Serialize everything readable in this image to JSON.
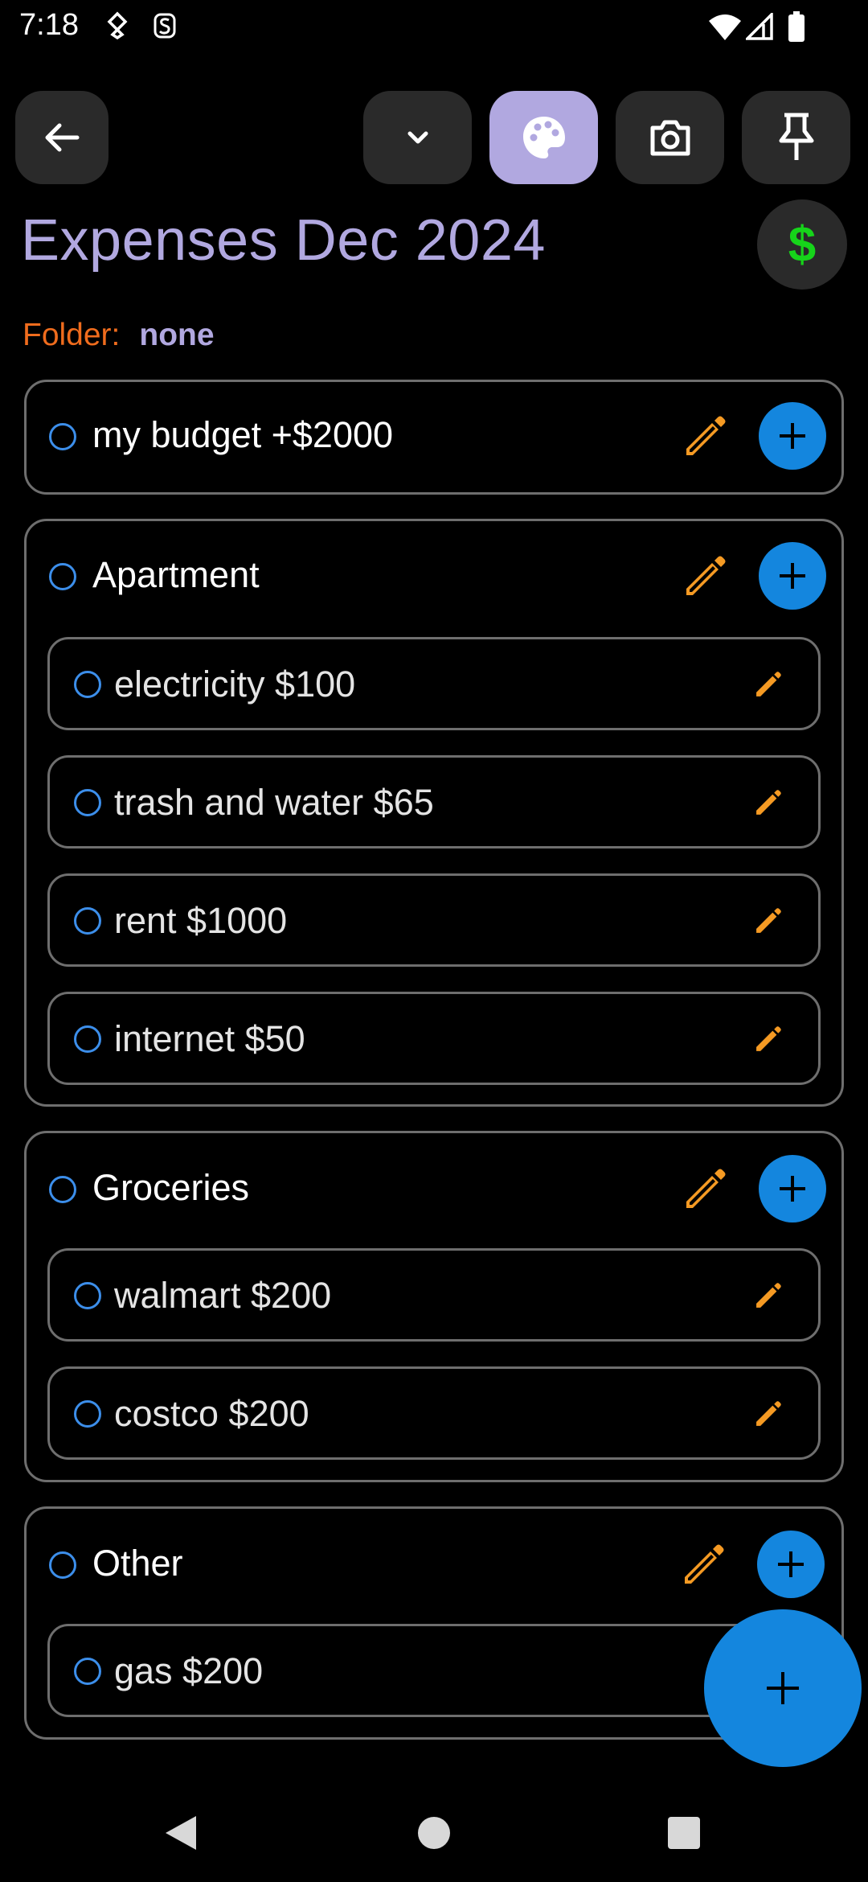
{
  "status_bar": {
    "time": "7:18",
    "left_icons": [
      "key-icon",
      "s-badge-icon"
    ],
    "right_icons": [
      "wifi-icon",
      "signal-icon",
      "battery-icon"
    ]
  },
  "toolbar": {
    "buttons": [
      "back-arrow-icon",
      "chevron-down-icon",
      "palette-icon",
      "camera-icon",
      "pin-icon"
    ],
    "active_button": "palette-icon"
  },
  "note": {
    "title": "Expenses Dec 2024",
    "currency_button": "$",
    "folder_label": "Folder:",
    "folder_value": "none"
  },
  "groups": [
    {
      "title": "my budget +$2000",
      "items": []
    },
    {
      "title": "Apartment",
      "items": [
        "electricity $100",
        "trash and water $65",
        "rent $1000",
        "internet $50"
      ]
    },
    {
      "title": "Groceries",
      "items": [
        "walmart $200",
        "costco $200"
      ]
    },
    {
      "title": "Other",
      "items": [
        "gas $200"
      ]
    }
  ],
  "colors": {
    "background": "#000000",
    "accent": "#b1a8e0",
    "folder_label": "#f06c1d",
    "edit_pencil": "#f59a23",
    "add_button": "#1486de",
    "checkbox": "#3c8eea",
    "dollar": "#16d41a"
  }
}
